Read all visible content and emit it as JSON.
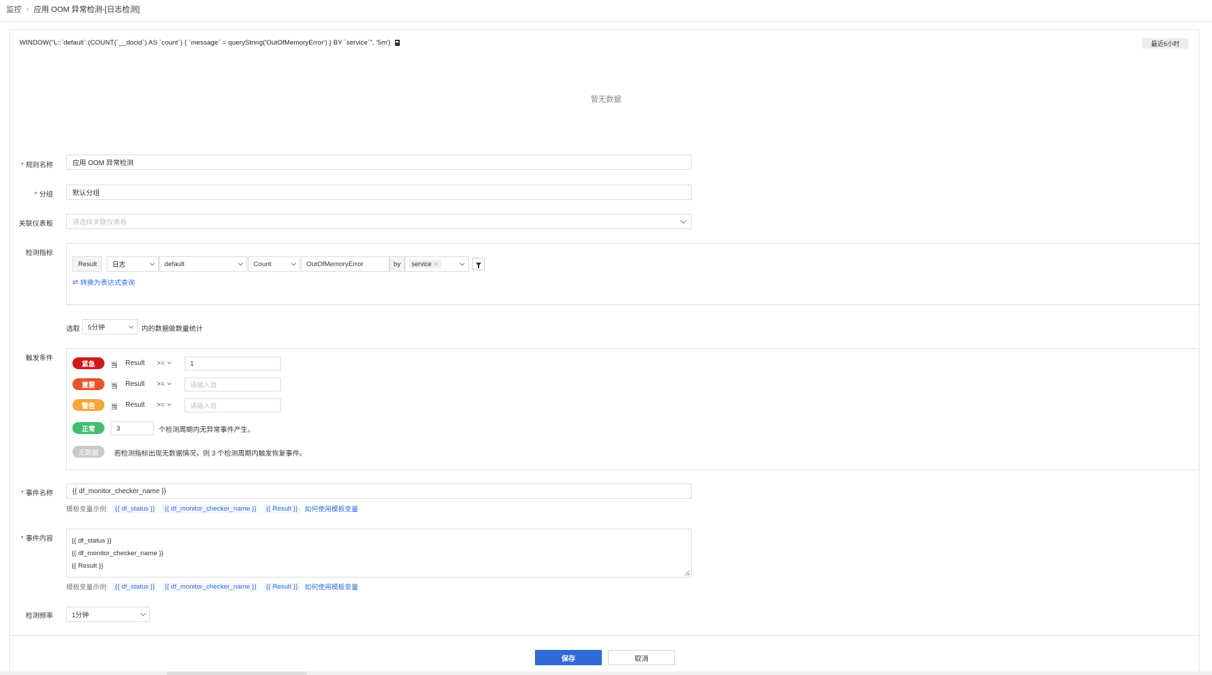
{
  "breadcrumb": {
    "root": "监控",
    "current": "应用 OOM 异常检测-[日志检测]"
  },
  "query": {
    "text": "WINDOW(\"L::`default`:(COUNT(`__docid`) AS `count`) { `message` = queryString('OutOfMemoryError') } BY `service`\", '5m')"
  },
  "time_range": "最近6小时",
  "chart": {
    "no_data": "暂无数据"
  },
  "form": {
    "rule_name": {
      "label": "规则名称",
      "value": "应用 OOM 异常检测"
    },
    "group": {
      "label": "分组",
      "value": "默认分组"
    },
    "dashboard": {
      "label": "关联仪表板",
      "placeholder": "请选择关联仪表板"
    },
    "metric": {
      "label": "检测指标",
      "result": "Result",
      "source": "日志",
      "index": "default",
      "agg": "Count",
      "keyword": "OutOfMemoryError",
      "by": "by",
      "by_tag": "service",
      "convert_link": "转换为表达式查询"
    },
    "window": {
      "prefix": "选取",
      "value": "5分钟",
      "suffix": "内的数据做数量统计"
    },
    "trigger": {
      "label": "触发条件",
      "rows": [
        {
          "level": "紧急",
          "color": "#d11a1a",
          "when": "当",
          "field": "Result",
          "op": ">=",
          "value": "1",
          "placeholder": ""
        },
        {
          "level": "重要",
          "color": "#e8542a",
          "when": "当",
          "field": "Result",
          "op": ">=",
          "value": "",
          "placeholder": "请输入值"
        },
        {
          "level": "警告",
          "color": "#f5a638",
          "when": "当",
          "field": "Result",
          "op": ">=",
          "value": "",
          "placeholder": "请输入值"
        }
      ],
      "normal": {
        "level": "正常",
        "color": "#3fbf6f",
        "value": "3",
        "text": "个检测周期内无异常事件产生。"
      },
      "nodata": {
        "level": "无数据",
        "color": "#c9c9c9",
        "text": "若检测指标出现无数据情况，则 3 个检测周期内触发恢复事件。"
      }
    },
    "event_name": {
      "label": "事件名称",
      "value": "{{ df_monitor_checker_name }}"
    },
    "vars": {
      "label": "模板变量示例:",
      "items": [
        "{{ df_status }}",
        "{{ df_monitor_checker_name }}",
        "{{ Result }}"
      ],
      "how": "如何使用模板变量"
    },
    "event_content": {
      "label": "事件内容",
      "lines": [
        "{{ df_status }}",
        "{{ df_monitor_checker_name }}",
        "{{ Result }}"
      ]
    },
    "frequency": {
      "label": "检测频率",
      "value": "1分钟"
    }
  },
  "footer": {
    "save": "保存",
    "cancel": "取消"
  },
  "colors": {
    "primary": "#2f6bd6",
    "required": "#e02020"
  }
}
